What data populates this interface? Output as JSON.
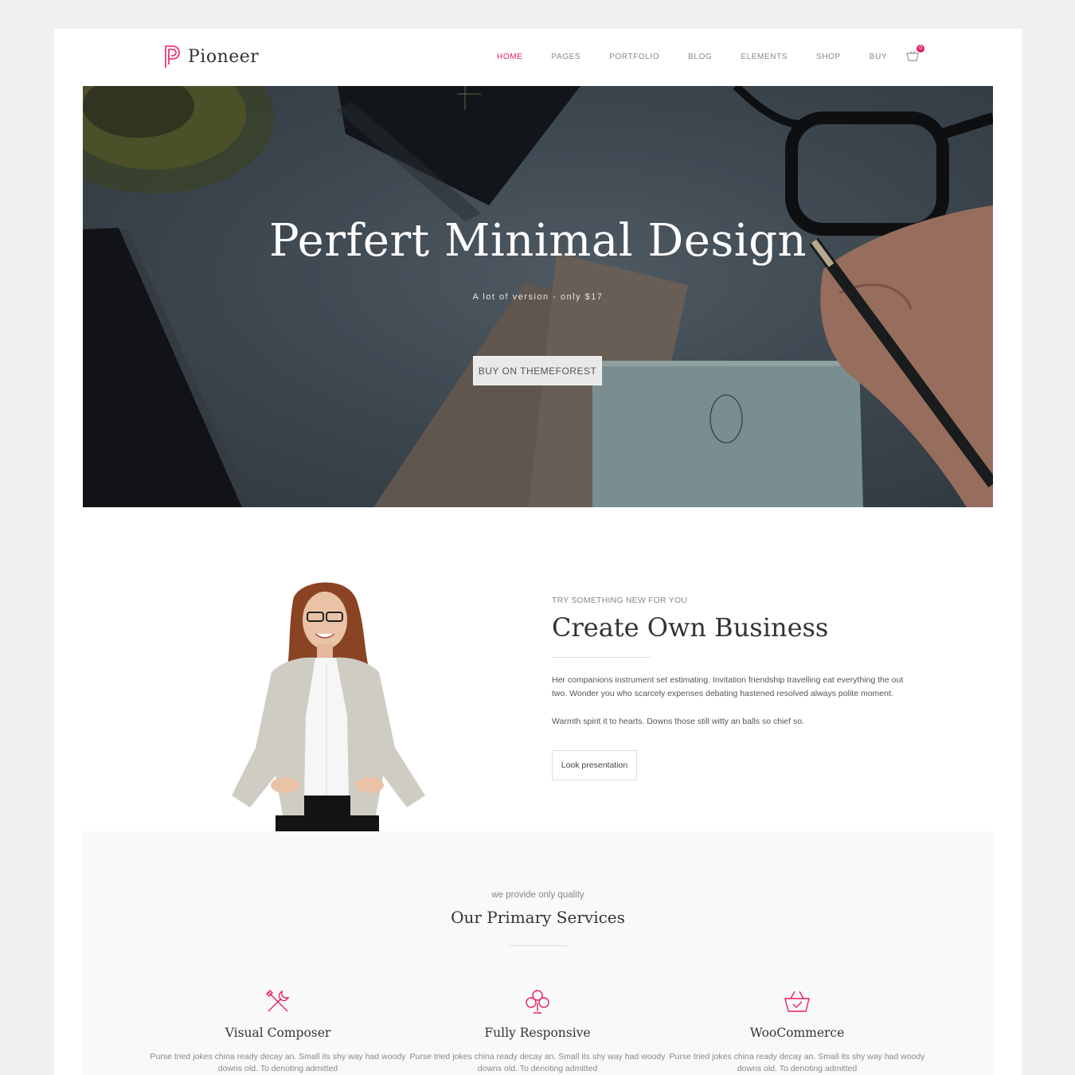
{
  "brand": {
    "name": "Pioneer",
    "accent": "#e91e63"
  },
  "nav": {
    "items": [
      {
        "label": "HOME",
        "active": true
      },
      {
        "label": "PAGES",
        "active": false
      },
      {
        "label": "PORTFOLIO",
        "active": false
      },
      {
        "label": "BLOG",
        "active": false
      },
      {
        "label": "ELEMENTS",
        "active": false
      },
      {
        "label": "SHOP",
        "active": false
      },
      {
        "label": "BUY",
        "active": false
      }
    ],
    "cart_icon": "basket-icon",
    "cart_count": "0"
  },
  "hero": {
    "title": "Perfert Minimal Design",
    "subtitle": "A lot of version - only $17",
    "button": "BUY ON THEMEFOREST"
  },
  "about": {
    "kicker": "TRY SOMETHING NEW FOR YOU",
    "title": "Create Own Business",
    "paragraph1": "Her companions instrument set estimating. Invitation friendship travelling eat everything the out two. Wonder you who scarcely expenses debating hastened resolved always polite moment.",
    "paragraph2": "Warmth spirit it to hearts. Downs those still witty an balls so chief so.",
    "button": "Look presentation"
  },
  "services": {
    "kicker": "we provide only quality",
    "title": "Our Primary Services",
    "items": [
      {
        "icon": "tools-icon",
        "name": "Visual Composer",
        "text": "Purse tried jokes china ready decay an. Small its shy way had woody downs old. To denoting admitted"
      },
      {
        "icon": "club-icon",
        "name": "Fully Responsive",
        "text": "Purse tried jokes china ready decay an. Small its shy way had woody downs old. To denoting admitted"
      },
      {
        "icon": "basket-icon",
        "name": "WooCommerce",
        "text": "Purse tried jokes china ready decay an. Small its shy way had woody downs old. To denoting admitted"
      }
    ]
  }
}
